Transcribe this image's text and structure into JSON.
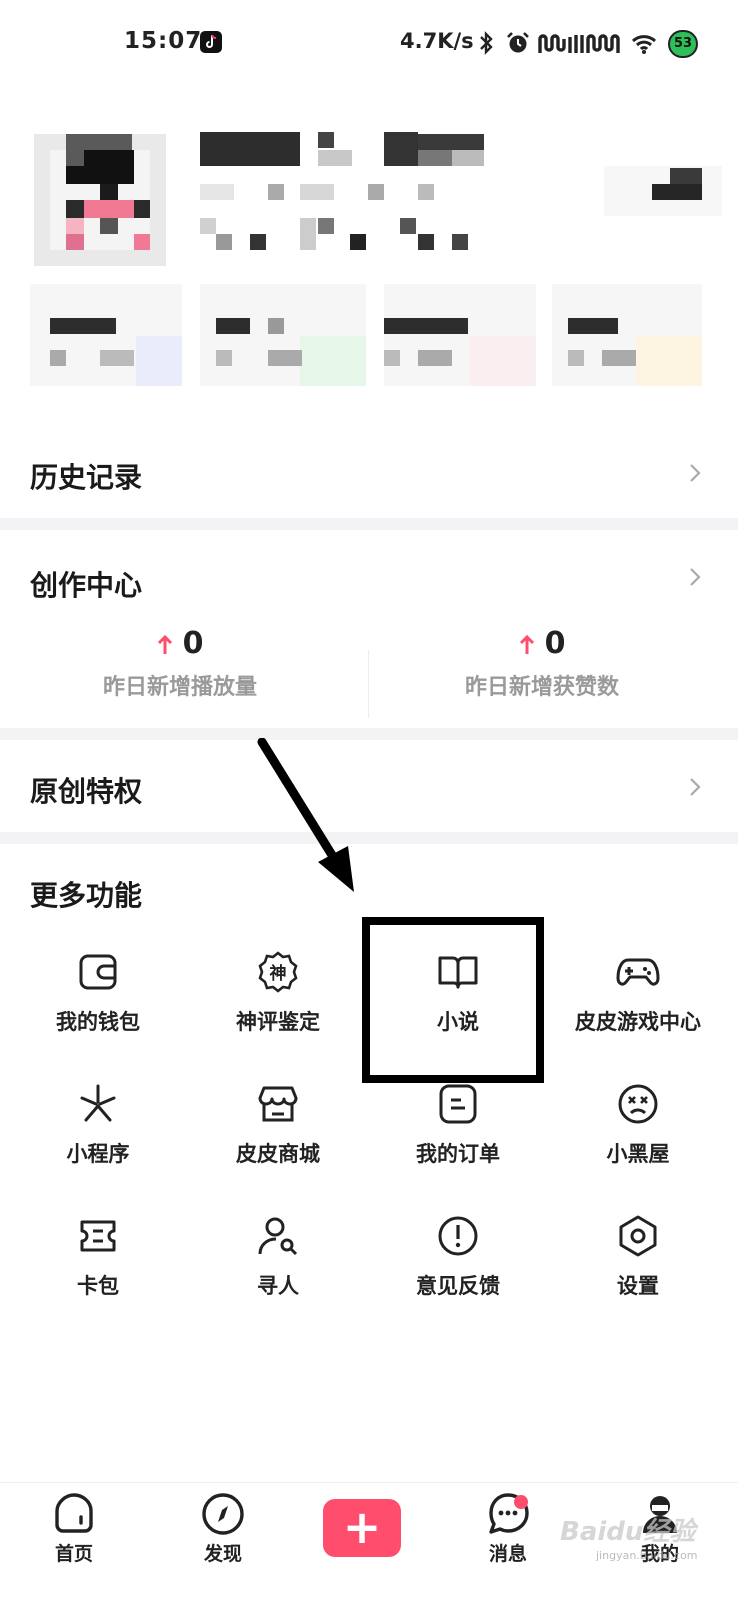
{
  "status_bar": {
    "time": "15:07",
    "network_speed": "4.7K/s",
    "battery": "53",
    "icons": [
      "tiktok-icon",
      "bluetooth-icon",
      "alarm-icon",
      "signal-icon",
      "signal-icon",
      "wifi-icon"
    ]
  },
  "profile": {
    "redacted": true
  },
  "sections": {
    "history": {
      "title": "历史记录"
    },
    "creation_center": {
      "title": "创作中心",
      "stats": [
        {
          "value": "0",
          "label": "昨日新增播放量"
        },
        {
          "value": "0",
          "label": "昨日新增获赞数"
        }
      ]
    },
    "original_privilege": {
      "title": "原创特权"
    },
    "more_features": {
      "title": "更多功能",
      "items": [
        {
          "label": "我的钱包",
          "icon": "wallet-icon"
        },
        {
          "label": "神评鉴定",
          "icon": "shen-badge-icon",
          "glyph": "神"
        },
        {
          "label": "小说",
          "icon": "book-icon"
        },
        {
          "label": "皮皮游戏中心",
          "icon": "gamepad-icon"
        },
        {
          "label": "小程序",
          "icon": "mini-program-icon"
        },
        {
          "label": "皮皮商城",
          "icon": "shop-icon"
        },
        {
          "label": "我的订单",
          "icon": "order-icon"
        },
        {
          "label": "小黑屋",
          "icon": "dizzy-face-icon"
        },
        {
          "label": "卡包",
          "icon": "ticket-icon"
        },
        {
          "label": "寻人",
          "icon": "find-person-icon"
        },
        {
          "label": "意见反馈",
          "icon": "feedback-icon"
        },
        {
          "label": "设置",
          "icon": "settings-icon"
        }
      ]
    }
  },
  "bottom_nav": {
    "items": [
      {
        "label": "首页",
        "icon": "home-icon"
      },
      {
        "label": "发现",
        "icon": "compass-icon"
      },
      {
        "label": "",
        "icon": "plus-icon"
      },
      {
        "label": "消息",
        "icon": "message-icon"
      },
      {
        "label": "我的",
        "icon": "profile-icon"
      }
    ],
    "plus_symbol": "+",
    "message_badge": true
  },
  "watermark": {
    "text": "Baidu经验",
    "sub": "jingyan.baidu.com"
  },
  "colors": {
    "accent": "#ff4d6d",
    "divider": "#f3f3f5",
    "muted_text": "#9a9a9a",
    "battery": "#2fbf5a"
  }
}
